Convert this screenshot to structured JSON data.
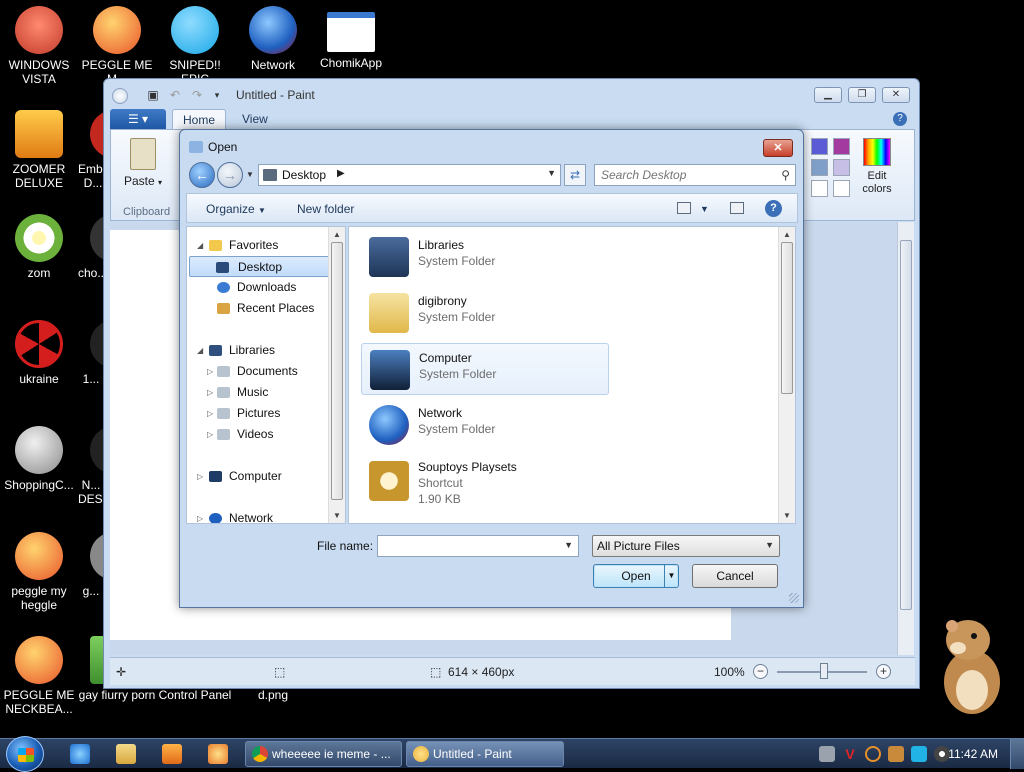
{
  "desktop_icons": [
    {
      "label": "WINDOWS VISTA",
      "icon": "vista-icon",
      "color": "#c23a2c"
    },
    {
      "label": "PEGGLE ME M...",
      "icon": "peggle-icon",
      "color": "#e8552a"
    },
    {
      "label": "SNIPED!! EPIC",
      "icon": "skype-icon",
      "color": "#19a7e6"
    },
    {
      "label": "Network",
      "icon": "network-icon",
      "color": "#1e5fbf"
    },
    {
      "label": "ChomikApp",
      "icon": "window-icon",
      "color": "#ffffff"
    },
    {
      "label": "ZOOMER DELUXE",
      "icon": "zoomer-icon",
      "color": "#e79a1f"
    },
    {
      "label": "Emb... D...",
      "icon": "app-icon",
      "color": "#c2281e"
    },
    {
      "label": "zom",
      "icon": "flower-icon",
      "color": "#6bb13b"
    },
    {
      "label": "cho...",
      "icon": "app-icon",
      "color": "#ffffff"
    },
    {
      "label": "ukraine",
      "icon": "radiation-icon",
      "color": "#d41e1e"
    },
    {
      "label": "1...",
      "icon": "app-icon",
      "color": "#ffffff"
    },
    {
      "label": "ShoppingC...",
      "icon": "flash-icon",
      "color": "#8a8a8a"
    },
    {
      "label": "N... DES...",
      "icon": "app-icon",
      "color": "#ffffff"
    },
    {
      "label": "peggle my heggle",
      "icon": "peggle-icon",
      "color": "#e8552a"
    },
    {
      "label": "g...",
      "icon": "app-icon",
      "color": "#888888"
    },
    {
      "label": "PEGGLE ME NECKBEA...",
      "icon": "peggle-icon",
      "color": "#e8552a"
    },
    {
      "label": "gay fiurry porn",
      "icon": "folder-icon",
      "color": "#3f8f2f"
    },
    {
      "label": "Control Panel",
      "icon": "control-panel-icon",
      "color": "#000000"
    },
    {
      "label": "d.png",
      "icon": "image-file-icon",
      "color": "#000000"
    }
  ],
  "paint": {
    "title": "Untitled - Paint",
    "tabs": [
      "Home",
      "View"
    ],
    "paste_label": "Paste",
    "clipboard_label": "Clipboard",
    "edit_colors_label": "Edit colors",
    "swatches": [
      "#5b5bd6",
      "#a23aa0",
      "#7f9ec8",
      "#c8bfe7",
      "#ffffff",
      "#ffffff"
    ],
    "status_size": "614 × 460px",
    "zoom": "100%"
  },
  "dialog": {
    "title": "Open",
    "location": "Desktop",
    "search_placeholder": "Search Desktop",
    "organize": "Organize",
    "new_folder": "New folder",
    "nav": {
      "favorites": "Favorites",
      "desktop": "Desktop",
      "downloads": "Downloads",
      "recent": "Recent Places",
      "libraries": "Libraries",
      "documents": "Documents",
      "music": "Music",
      "pictures": "Pictures",
      "videos": "Videos",
      "computer": "Computer",
      "network": "Network"
    },
    "files": [
      {
        "name": "Libraries",
        "type": "System Folder",
        "icon": "libraries-icon",
        "color": "#2f4f7f"
      },
      {
        "name": "digibrony",
        "type": "System Folder",
        "icon": "user-folder-icon",
        "color": "#e9c46a"
      },
      {
        "name": "Computer",
        "type": "System Folder",
        "icon": "computer-icon",
        "color": "#1f3c66"
      },
      {
        "name": "Network",
        "type": "System Folder",
        "icon": "network-icon",
        "color": "#1e5fbf"
      },
      {
        "name": "Souptoys Playsets",
        "type": "Shortcut",
        "size": "1.90 KB",
        "icon": "shortcut-icon",
        "color": "#c7962c"
      }
    ],
    "filename_label": "File name:",
    "filename_value": "",
    "filter": "All Picture Files",
    "open": "Open",
    "cancel": "Cancel"
  },
  "taskbar": {
    "tasks": [
      {
        "label": "wheeeee ie meme - ...",
        "icon": "chrome-icon",
        "color": "#db4437"
      },
      {
        "label": "Untitled - Paint",
        "icon": "paint-icon",
        "color": "#e8b23b"
      }
    ],
    "time": "11:42 AM"
  }
}
